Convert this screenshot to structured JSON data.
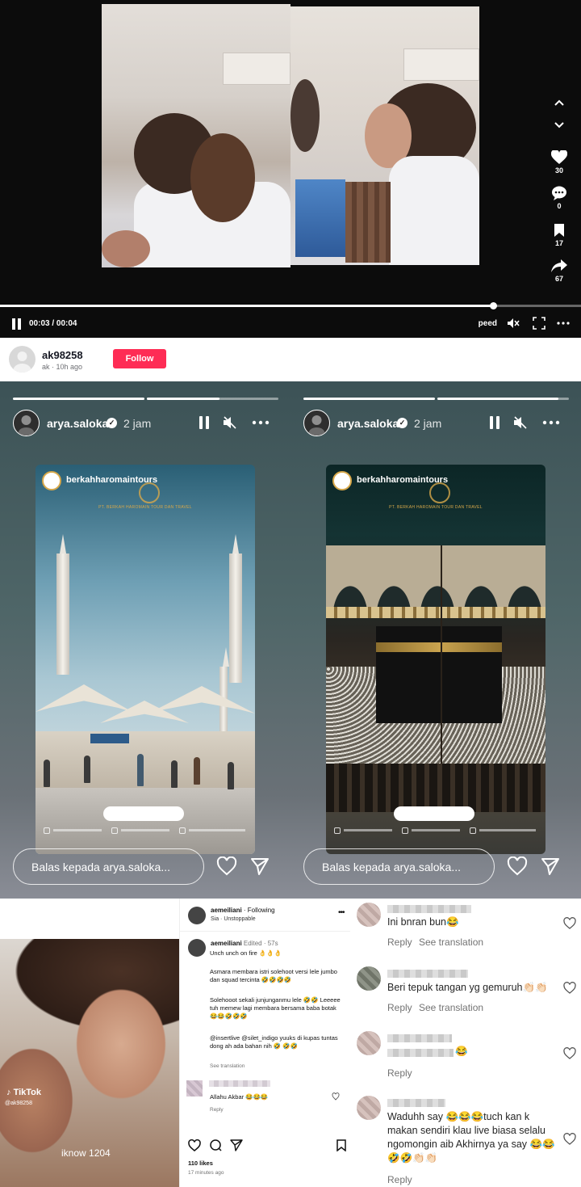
{
  "tiktok": {
    "time": "00:03 / 00:04",
    "speed_label": "Speed",
    "progress_fraction": 0.85,
    "likes": "30",
    "comments": "0",
    "saves": "17",
    "shares": "67",
    "username": "ak98258",
    "sub": "ak · 10h ago",
    "follow_label": "Follow"
  },
  "stories": [
    {
      "username": "arya.saloka",
      "time": "2 jam",
      "brand": "berkahharomaintours",
      "brand_sub": "PT. BERKAH HAROMAIN TOUR DAN TRAVEL",
      "reply_placeholder": "Balas kepada arya.saloka..."
    },
    {
      "username": "arya.saloka",
      "time": "2 jam",
      "brand": "berkahharomaintours",
      "brand_sub": "PT. BERKAH HAROMAIN TOUR DAN TRAVEL",
      "reply_placeholder": "Balas kepada arya.saloka..."
    }
  ],
  "photo": {
    "tiktok_label": "TikTok",
    "handle": "@ak98258",
    "caption": "iknow 1204"
  },
  "ig_post": {
    "username": "aemeiliani",
    "following": "Following",
    "audio": "Sia · Unstoppable",
    "caption_user": "aemeiliani",
    "caption_meta": "Edited · 57s",
    "caption_lines": [
      "Unch unch on fire 👌👌👌",
      "Asmara membara istri solehoot versi lele jumbo dan squad tercinta 🤣🤣🤣🤣",
      "Solehooot sekali junjunganmu lele 🤣🤣 Leeeee tuh memew lagi membara bersama baba botak 😂😂🤣🤣🤣",
      "@insertlive @silet_indigo yuuks di kupas tuntas dong ah ada bahan nih 🤣 🤣🤣"
    ],
    "see_translation": "See translation",
    "comment_text": "Allahu Akbar 😂😂😂",
    "comment_reply": "Reply",
    "likes": "110 likes",
    "ago": "17 minutes ago"
  },
  "comments": [
    {
      "text": "Ini bnran bun😂",
      "reply": "Reply",
      "translate": "See translation"
    },
    {
      "text": "Beri tepuk tangan yg gemuruh👏🏻👏🏻",
      "reply": "Reply",
      "translate": "See translation"
    },
    {
      "text": "😂",
      "reply": "Reply"
    },
    {
      "text": "Waduhh say 😂😂😂tuch kan k makan sendiri klau live biasa selalu ngomongin aib Akhirnya ya say 😂😂🤣🤣👏🏻👏🏻",
      "reply": "Reply"
    }
  ],
  "colors": {
    "follow": "#fe2c55",
    "story_bg": "#4f6668",
    "gold": "#d7a84a"
  }
}
